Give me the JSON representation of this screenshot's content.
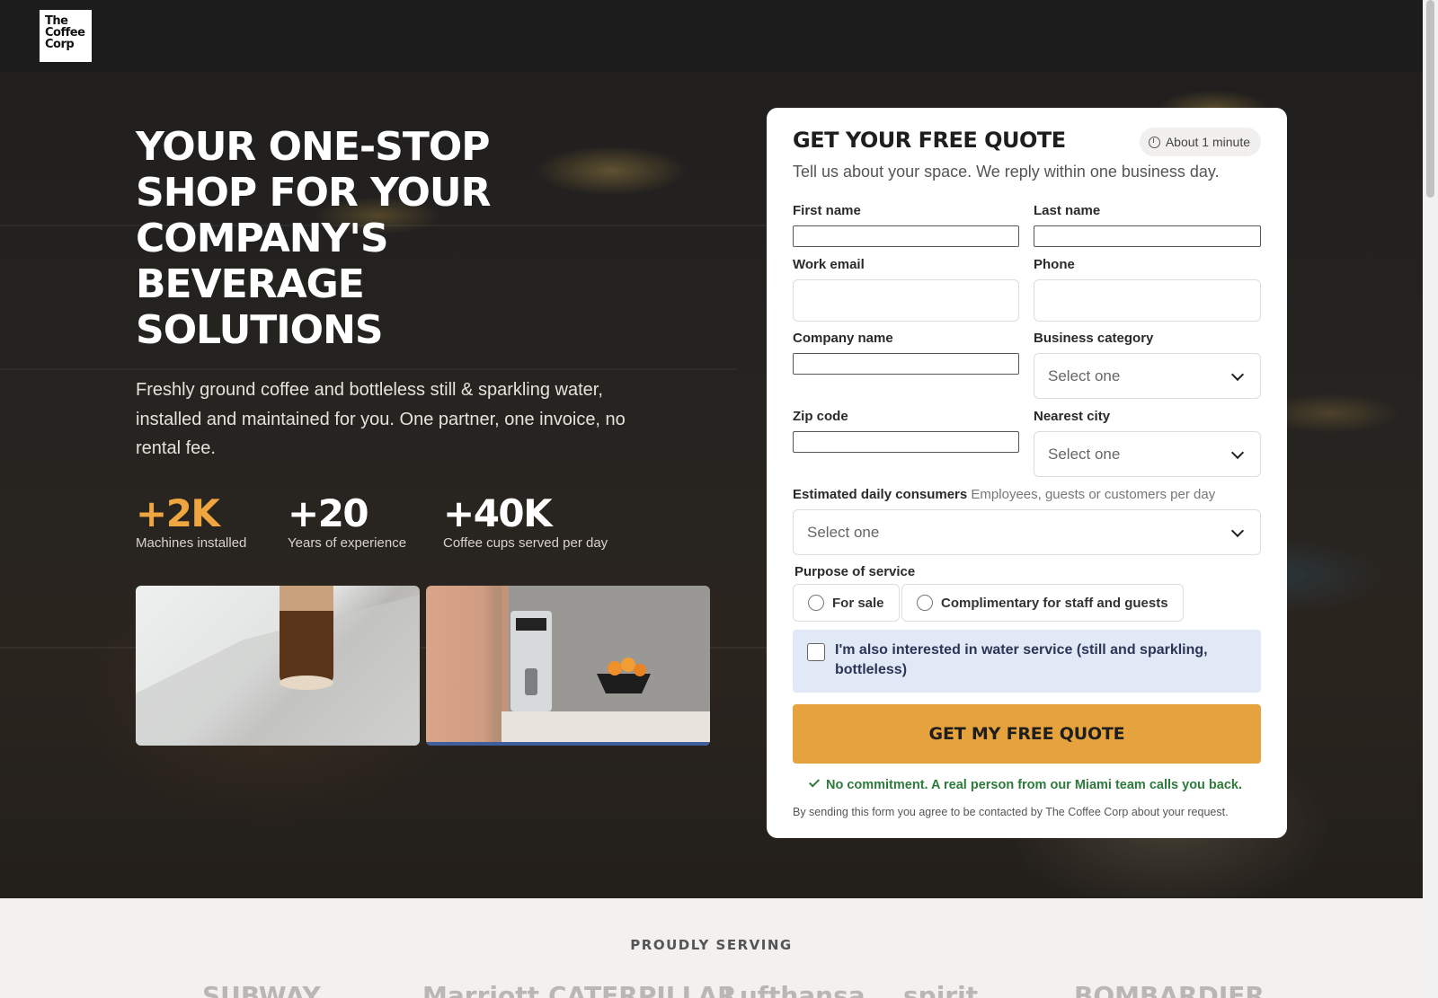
{
  "brand": {
    "logo_line1": "The",
    "logo_line2": "Coffee",
    "logo_line3": "Corp"
  },
  "hero": {
    "headline_1": "YOUR ONE-STOP",
    "headline_2": "SHOP FOR YOUR",
    "headline_3": "COMPANY'S",
    "headline_4": "BEVERAGE",
    "headline_5": "SOLUTIONS",
    "subtext": "Freshly ground coffee and bottleless still & sparkling water, installed and maintained for you. One partner, one invoice, no rental fee.",
    "stats": [
      {
        "value": "+2K",
        "label": "Machines installed"
      },
      {
        "value": "+20",
        "label": "Years of experience"
      },
      {
        "value": "+40K",
        "label": "Coffee cups served per day"
      }
    ]
  },
  "form": {
    "title": "GET YOUR FREE QUOTE",
    "subtitle": "Tell us about your space. We reply within one business day.",
    "badge": "About 1 minute",
    "first_name_label": "First name",
    "last_name_label": "Last name",
    "email_label": "Work email",
    "phone_label": "Phone",
    "company_label": "Company name",
    "category_label": "Business category",
    "category_value": "Select one",
    "zip_label": "Zip code",
    "city_label": "Nearest city",
    "city_value": "Select one",
    "consumers_label": "Estimated daily consumers",
    "consumers_hint": "Employees, guests or customers per day",
    "consumers_value": "Select one",
    "purpose_label": "Purpose of service",
    "purpose_options": [
      "For sale",
      "Complimentary for staff and guests"
    ],
    "water_text": "I'm also interested in water service (still and sparkling, bottleless)",
    "submit": "GET MY FREE QUOTE",
    "commitment": "No commitment. A real person from our Miami team calls you back.",
    "legal": "By sending this form you agree to be contacted by The Coffee Corp about your request."
  },
  "clients": {
    "heading": "PROUDLY SERVING",
    "logos": [
      "SUBWAY",
      "Marriott",
      "CATERPILLAR",
      "Lufthansa",
      "spirit",
      "BOMBARDIER"
    ]
  }
}
